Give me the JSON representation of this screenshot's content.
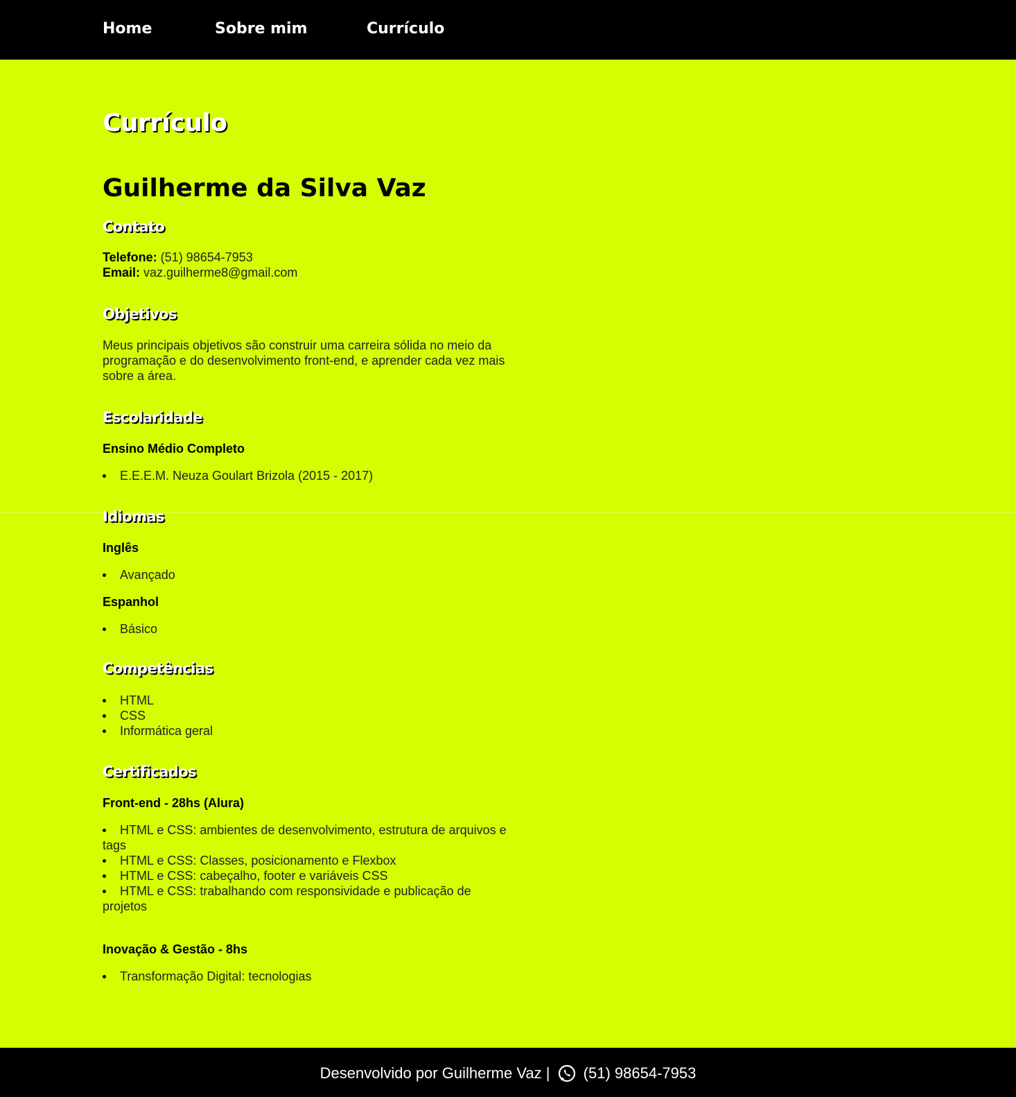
{
  "nav": {
    "home": "Home",
    "about": "Sobre mim",
    "cv": "Currículo"
  },
  "page": {
    "title": "Currículo",
    "name": "Guilherme da Silva Vaz"
  },
  "contato": {
    "title": "Contato",
    "phone_label": "Telefone:",
    "phone": " (51) 98654-7953",
    "email_label": "Email:",
    "email": " vaz.guilherme8@gmail.com"
  },
  "objetivos": {
    "title": "Objetivos",
    "text": "Meus principais objetivos são construir uma carreira sólida no meio da programação e do desenvolvimento front-end, e aprender cada vez mais sobre a área."
  },
  "escolaridade": {
    "title": "Escolaridade",
    "subtitle": "Ensino Médio Completo",
    "items": [
      "E.E.E.M. Neuza Goulart Brizola (2015 - 2017)"
    ]
  },
  "idiomas": {
    "title": "Idiomas",
    "ingles": {
      "label": "Inglês",
      "level": "Avançado"
    },
    "espanhol": {
      "label": "Espanhol",
      "level": "Básico"
    }
  },
  "competencias": {
    "title": "Competências",
    "items": [
      "HTML",
      "CSS",
      "Informática geral"
    ]
  },
  "certificados": {
    "title": "Certificados",
    "frontend": {
      "label": "Front-end - 28hs (Alura)",
      "items": [
        "HTML e CSS: ambientes de desenvolvimento, estrutura de arquivos e tags",
        "HTML e CSS: Classes, posicionamento e Flexbox",
        "HTML e CSS: cabeçalho, footer e variáveis CSS",
        "HTML e CSS: trabalhando com responsividade e publicação de projetos"
      ]
    },
    "inovacao": {
      "label": "Inovação & Gestão - 8hs",
      "items": [
        "Transformação Digital: tecnologias"
      ]
    }
  },
  "footer": {
    "text": "Desenvolvido por Guilherme Vaz |",
    "phone": "(51) 98654-7953"
  },
  "colors": {
    "background": "#d4ff00",
    "header": "#000000",
    "footer": "#000000"
  },
  "icons": [
    "whatsapp-icon"
  ]
}
